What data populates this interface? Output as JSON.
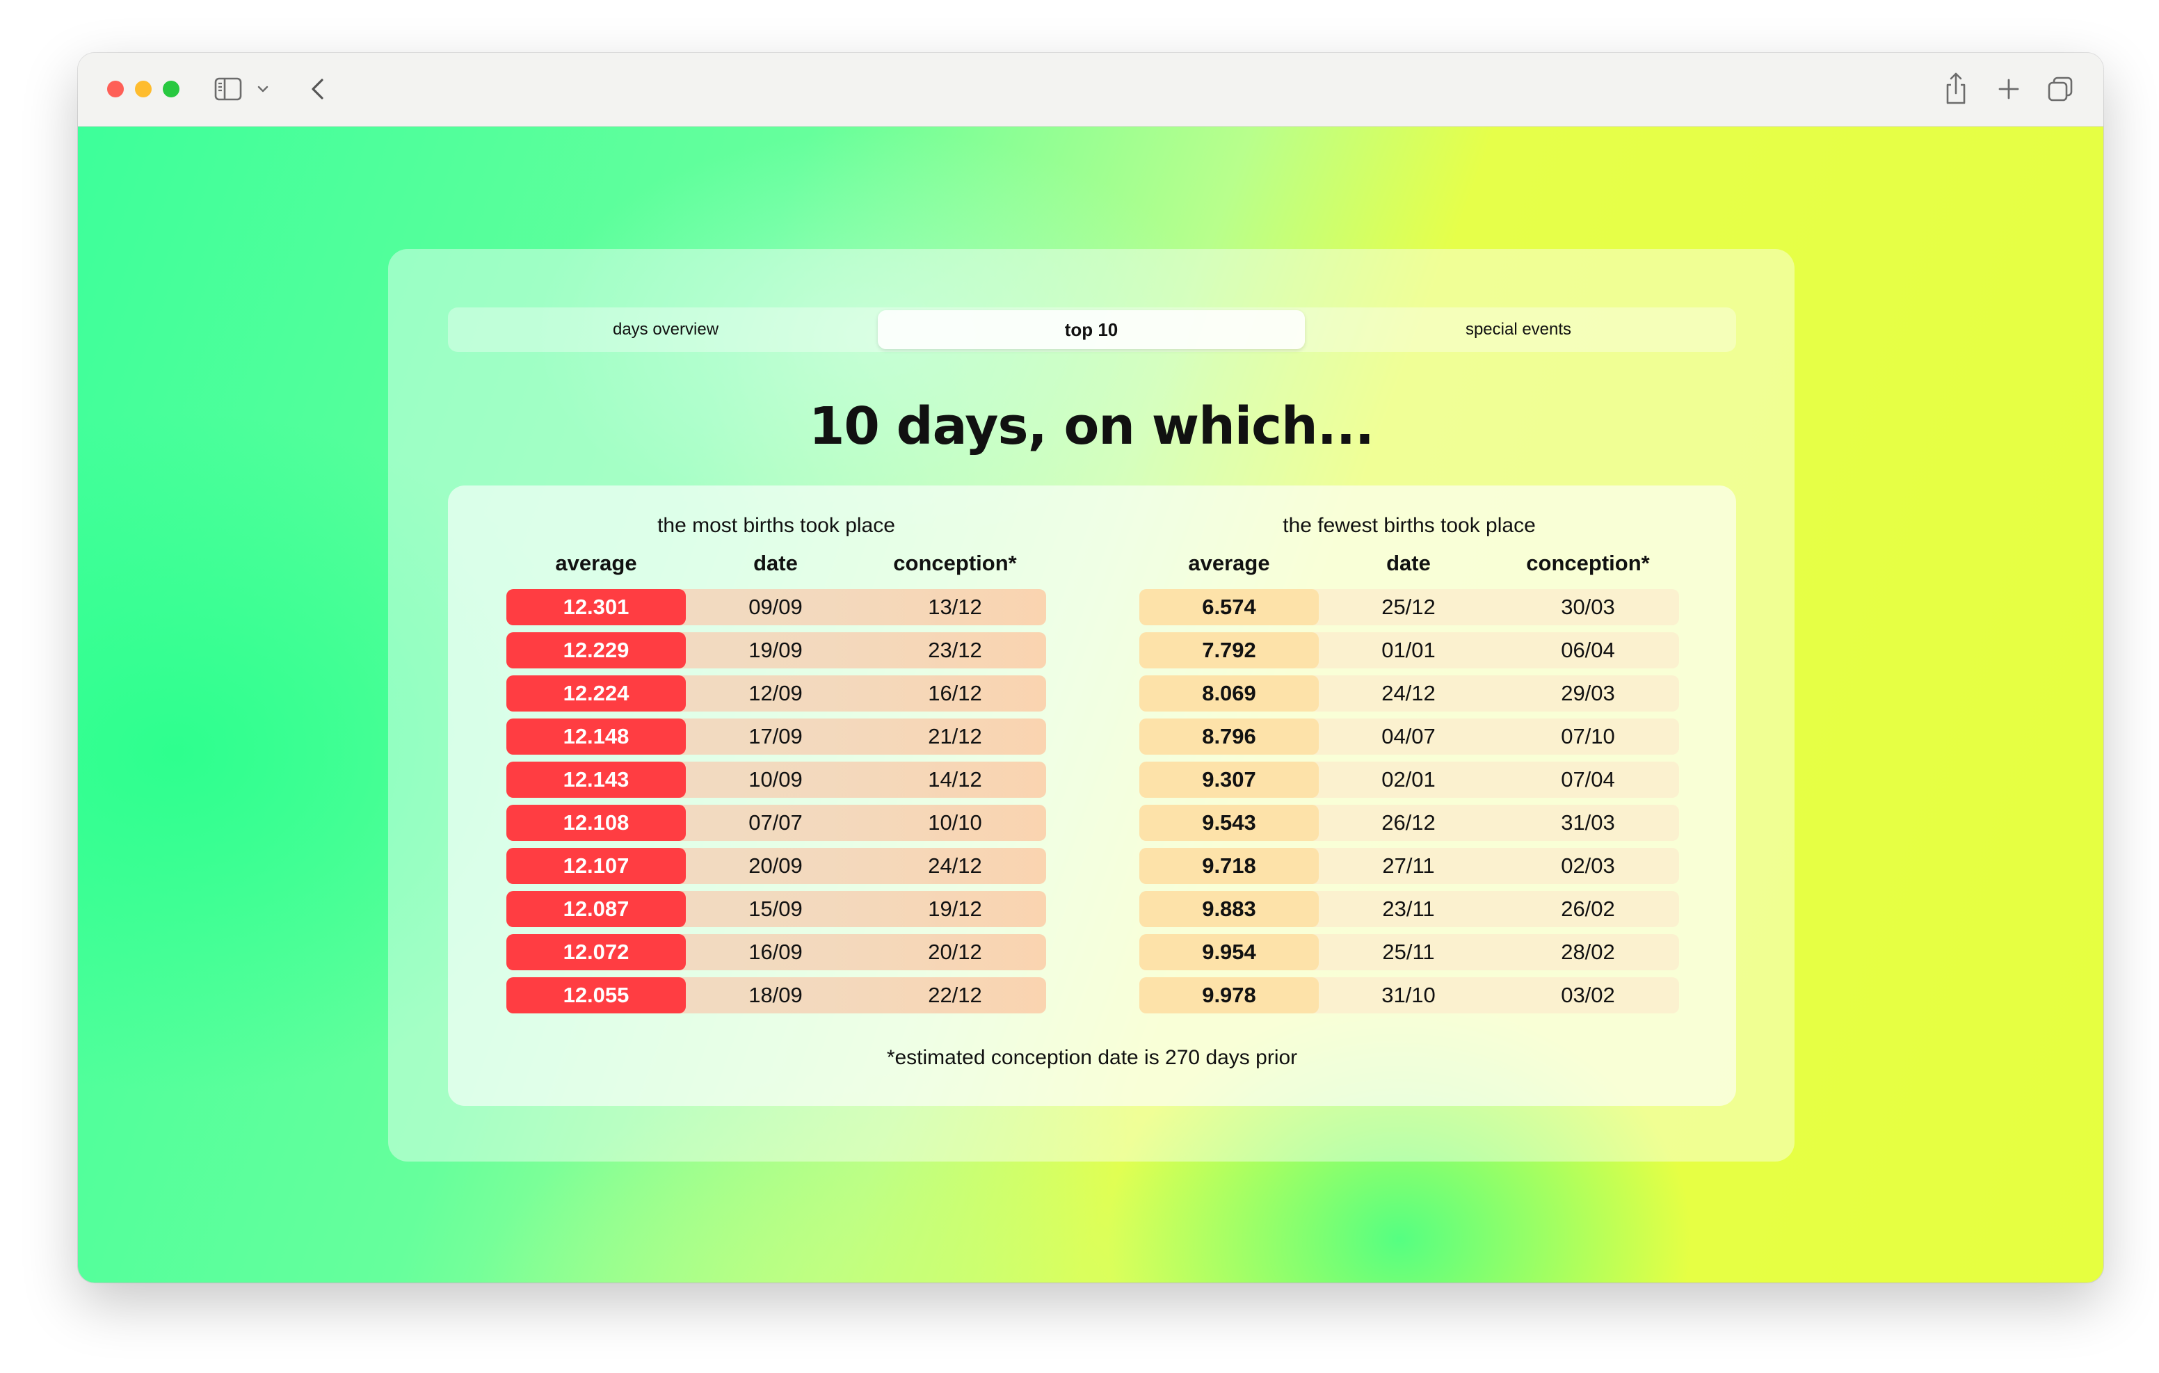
{
  "browser": {
    "icons": [
      "sidebar-icon",
      "chevron-down-icon",
      "back-icon",
      "share-icon",
      "plus-icon",
      "tabs-icon"
    ]
  },
  "tabs": [
    {
      "label": "days overview",
      "active": false
    },
    {
      "label": "top 10",
      "active": true
    },
    {
      "label": "special events",
      "active": false
    }
  ],
  "heading": "10 days, on which...",
  "columns": {
    "average": "average",
    "date": "date",
    "conception": "conception*"
  },
  "most": {
    "title": "the most births took place",
    "accent": "#ff3d42",
    "rows": [
      {
        "average": "12.301",
        "date": "09/09",
        "conception": "13/12"
      },
      {
        "average": "12.229",
        "date": "19/09",
        "conception": "23/12"
      },
      {
        "average": "12.224",
        "date": "12/09",
        "conception": "16/12"
      },
      {
        "average": "12.148",
        "date": "17/09",
        "conception": "21/12"
      },
      {
        "average": "12.143",
        "date": "10/09",
        "conception": "14/12"
      },
      {
        "average": "12.108",
        "date": "07/07",
        "conception": "10/10"
      },
      {
        "average": "12.107",
        "date": "20/09",
        "conception": "24/12"
      },
      {
        "average": "12.087",
        "date": "15/09",
        "conception": "19/12"
      },
      {
        "average": "12.072",
        "date": "16/09",
        "conception": "20/12"
      },
      {
        "average": "12.055",
        "date": "18/09",
        "conception": "22/12"
      }
    ]
  },
  "fewest": {
    "title": "the fewest births took place",
    "accent": "#fde2a9",
    "rows": [
      {
        "average": "6.574",
        "date": "25/12",
        "conception": "30/03"
      },
      {
        "average": "7.792",
        "date": "01/01",
        "conception": "06/04"
      },
      {
        "average": "8.069",
        "date": "24/12",
        "conception": "29/03"
      },
      {
        "average": "8.796",
        "date": "04/07",
        "conception": "07/10"
      },
      {
        "average": "9.307",
        "date": "02/01",
        "conception": "07/04"
      },
      {
        "average": "9.543",
        "date": "26/12",
        "conception": "31/03"
      },
      {
        "average": "9.718",
        "date": "27/11",
        "conception": "02/03"
      },
      {
        "average": "9.883",
        "date": "23/11",
        "conception": "26/02"
      },
      {
        "average": "9.954",
        "date": "25/11",
        "conception": "28/02"
      },
      {
        "average": "9.978",
        "date": "31/10",
        "conception": "03/02"
      }
    ]
  },
  "footnote": "*estimated conception date is 270 days prior"
}
